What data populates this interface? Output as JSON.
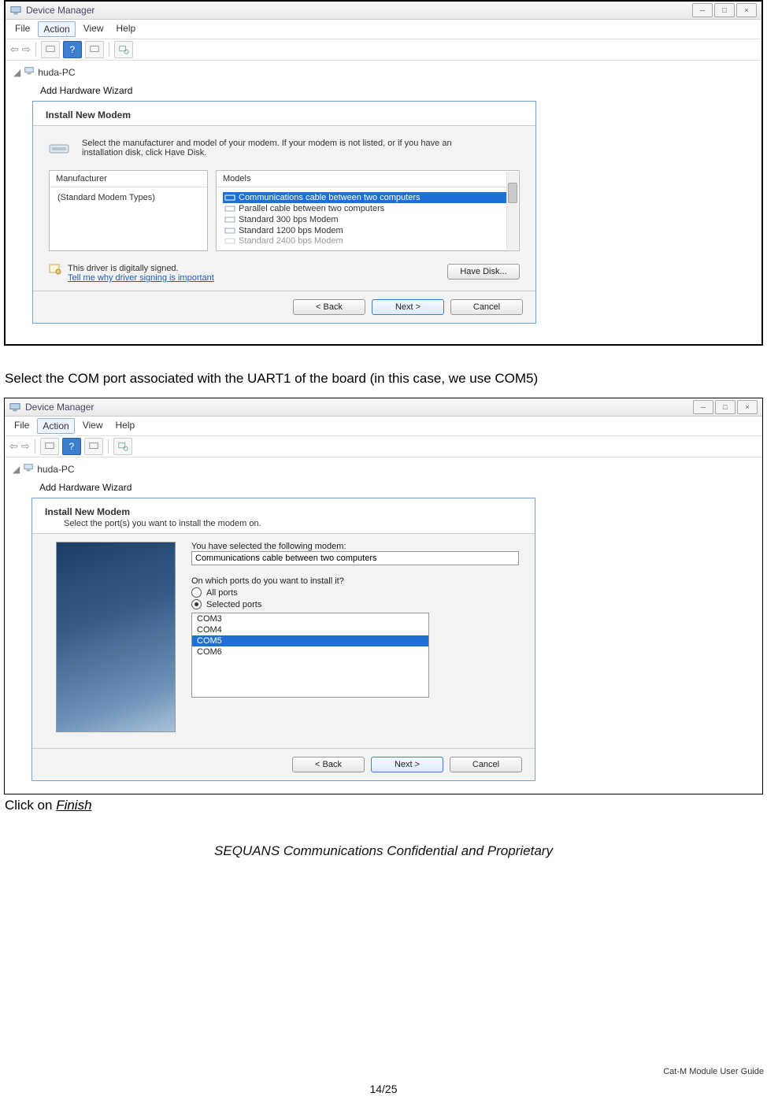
{
  "window": {
    "title": "Device Manager",
    "controls": {
      "min": "─",
      "max": "□",
      "close": "×"
    },
    "menu": {
      "file": "File",
      "action": "Action",
      "view": "View",
      "help": "Help"
    },
    "tree_root": "huda-PC"
  },
  "dialog1": {
    "wizard_title": "Add Hardware Wizard",
    "heading": "Install New Modem",
    "instruction": "Select the manufacturer and model of your modem. If your modem is not listed, or if you have an installation disk, click Have Disk.",
    "columns": {
      "left": "Manufacturer",
      "right": "Models"
    },
    "manufacturer": "(Standard Modem Types)",
    "models": [
      "Communications cable between two computers",
      "Parallel cable between two computers",
      "Standard   300 bps Modem",
      "Standard  1200 bps Modem",
      "Standard   2400 bps Modem"
    ],
    "signed_text": "This driver is digitally signed.",
    "signed_link": "Tell me why driver signing is important",
    "have_disk": "Have Disk...",
    "buttons": {
      "back": "< Back",
      "next": "Next >",
      "cancel": "Cancel"
    }
  },
  "caption1": "Select the COM port associated with the UART1 of the board (in this case, we use COM5)",
  "dialog2": {
    "wizard_title": "Add Hardware Wizard",
    "heading": "Install New Modem",
    "subheading": "Select the port(s) you want to install the modem on.",
    "selected_label": "You have selected the following modem:",
    "selected_value": "Communications cable between two computers",
    "ports_question": "On which ports do you want to install it?",
    "radios": {
      "all": "All ports",
      "selected": "Selected ports"
    },
    "ports": [
      "COM3",
      "COM4",
      "COM5",
      "COM6"
    ],
    "selected_port": "COM5",
    "buttons": {
      "back": "< Back",
      "next": "Next >",
      "cancel": "Cancel"
    }
  },
  "caption2_prefix": "Click on ",
  "caption2_link": "Finish",
  "footer_conf": "SEQUANS Communications Confidential and Proprietary",
  "footer_doc": "Cat-M Module User Guide",
  "page_number": "14/25"
}
